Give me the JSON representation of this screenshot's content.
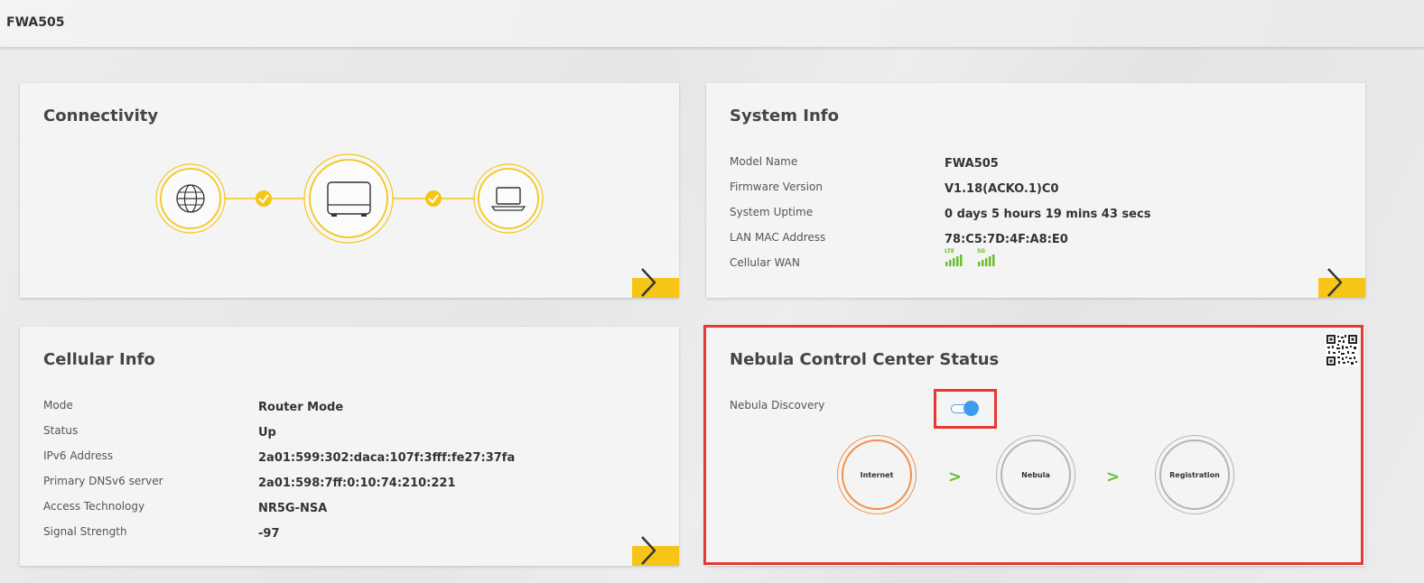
{
  "header": {
    "title": "FWA505"
  },
  "connectivity": {
    "title": "Connectivity",
    "nodes": [
      "globe-icon",
      "router-icon",
      "laptop-icon"
    ],
    "accent": "#f5c518"
  },
  "system_info": {
    "title": "System Info",
    "rows": [
      {
        "label": "Model Name",
        "value": "FWA505"
      },
      {
        "label": "Firmware Version",
        "value": "V1.18(ACKO.1)C0"
      },
      {
        "label": "System Uptime",
        "value": "0 days 5 hours 19 mins 43 secs"
      },
      {
        "label": "LAN MAC Address",
        "value": "78:C5:7D:4F:A8:E0"
      },
      {
        "label": "Cellular WAN",
        "value": ""
      }
    ],
    "cellular": [
      {
        "tech": "LTE",
        "bars": 5
      },
      {
        "tech": "5G",
        "bars": 5
      }
    ],
    "signal_color": "#6abf2e"
  },
  "cellular_info": {
    "title": "Cellular Info",
    "rows": [
      {
        "label": "Mode",
        "value": "Router Mode"
      },
      {
        "label": "Status",
        "value": "Up"
      },
      {
        "label": "IPv6 Address",
        "value": "2a01:599:302:daca:107f:3fff:fe27:37fa"
      },
      {
        "label": "Primary DNSv6 server",
        "value": "2a01:598:7ff:0:10:74:210:221"
      },
      {
        "label": "Access Technology",
        "value": "NR5G-NSA"
      },
      {
        "label": "Signal Strength",
        "value": "-97"
      }
    ]
  },
  "nebula": {
    "title": "Nebula Control Center Status",
    "discovery_label": "Nebula Discovery",
    "discovery_enabled": true,
    "steps": [
      {
        "label": "Internet",
        "color": "#f0904a"
      },
      {
        "label": "Nebula",
        "color": "#b5b5ad"
      },
      {
        "label": "Registration",
        "color": "#b5b5ad"
      }
    ],
    "arrow": ">",
    "highlight_color": "#e53935"
  }
}
